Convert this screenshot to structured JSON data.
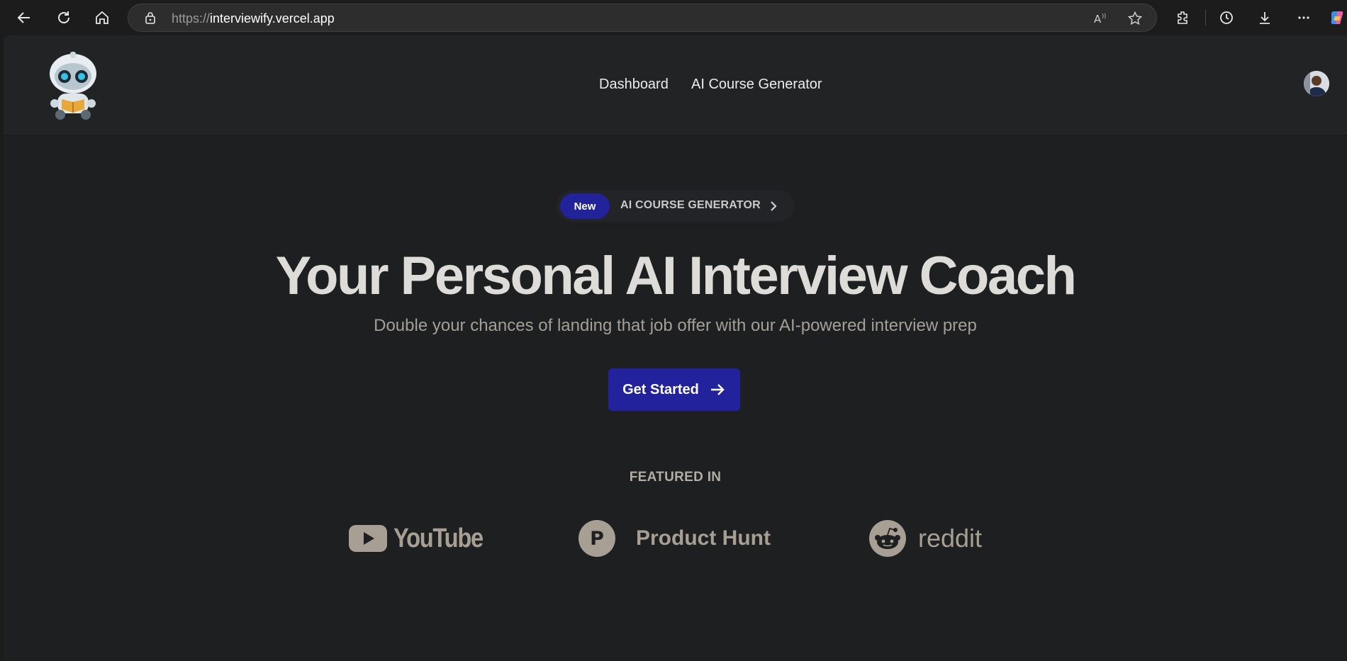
{
  "browser": {
    "url_protocol": "https://",
    "url_host": "interviewify.vercel.app"
  },
  "header": {
    "nav": [
      {
        "label": "Dashboard"
      },
      {
        "label": "AI Course Generator"
      }
    ]
  },
  "hero": {
    "badge": "New",
    "pill_label": "AI COURSE GENERATOR",
    "title": "Your Personal AI Interview Coach",
    "subtitle": "Double your chances of landing that job offer with our AI-powered interview prep",
    "cta_label": "Get Started"
  },
  "featured": {
    "heading": "FEATURED IN",
    "brands": [
      {
        "name": "YouTube",
        "icon": "youtube-icon"
      },
      {
        "name": "Product Hunt",
        "icon": "product-hunt-icon"
      },
      {
        "name": "reddit",
        "icon": "reddit-icon"
      }
    ]
  },
  "colors": {
    "accent": "#23229d",
    "background": "#1e1f21",
    "brand_logo": "#a79f93"
  }
}
